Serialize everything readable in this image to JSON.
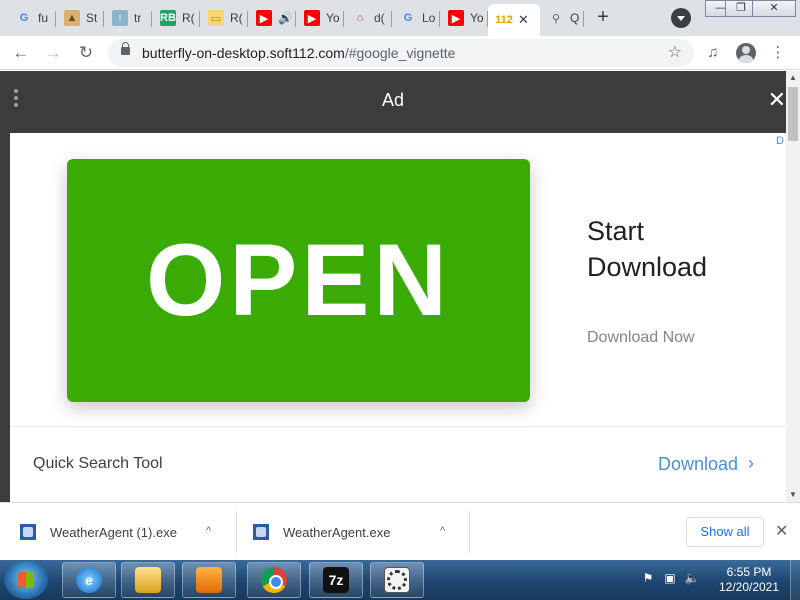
{
  "tabs": [
    {
      "icon": "google-icon",
      "glyph": "G",
      "color": "#4285f4",
      "bg": "transparent",
      "title": "fu"
    },
    {
      "icon": "animal-icon",
      "glyph": "▲",
      "color": "#6b4a1e",
      "bg": "#d9b16a",
      "title": "St"
    },
    {
      "icon": "upload-icon",
      "glyph": "↑",
      "color": "#ffffff",
      "bg": "#8ab4c8",
      "title": "tr"
    },
    {
      "icon": "rb-icon",
      "glyph": "RB",
      "color": "#ffffff",
      "bg": "#1fa463",
      "title": "R("
    },
    {
      "icon": "bookmark-folder-icon",
      "glyph": "▭",
      "color": "#b88a1a",
      "bg": "#f7d774",
      "title": "R("
    },
    {
      "icon": "youtube-icon",
      "glyph": "▶",
      "color": "#ffffff",
      "bg": "#ff0000",
      "title": "🔊"
    },
    {
      "icon": "youtube-icon",
      "glyph": "▶",
      "color": "#ffffff",
      "bg": "#ff0000",
      "title": "Yo"
    },
    {
      "icon": "store-icon",
      "glyph": "⌂",
      "color": "#e8413c",
      "bg": "transparent",
      "title": "d("
    },
    {
      "icon": "google-icon",
      "glyph": "G",
      "color": "#4285f4",
      "bg": "transparent",
      "title": "Lo"
    },
    {
      "icon": "youtube-icon",
      "glyph": "▶",
      "color": "#ffffff",
      "bg": "#ff0000",
      "title": "Yo"
    },
    {
      "icon": "soft112-icon",
      "glyph": "112",
      "color": "#e8a000",
      "bg": "transparent",
      "title": "",
      "active": true,
      "close": "✕"
    },
    {
      "icon": "search-icon",
      "glyph": "⚲",
      "color": "#5f6368",
      "bg": "transparent",
      "title": "Q"
    }
  ],
  "newtab_label": "+",
  "window": {
    "minimize": "—",
    "maximize": "❐",
    "close": "✕"
  },
  "toolbar": {
    "back": "←",
    "forward": "→",
    "reload": "↻",
    "url_host": "butterfly-on-desktop.soft112.com",
    "url_path": "/#google_vignette",
    "star": "☆",
    "media": "♫",
    "menu": "⋮"
  },
  "ad": {
    "label": "Ad",
    "close": "✕",
    "open_text": "OPEN",
    "headline": "Start Download",
    "download_now": "Download Now",
    "adchoices": "D",
    "quick_search": "Quick Search Tool",
    "download_link": "Download",
    "chevron": "›",
    "accent": "#3aaa05",
    "link_color": "#4a90d9"
  },
  "scroll": {
    "up": "▲",
    "down": "▼"
  },
  "shelf": {
    "items": [
      {
        "filename": "WeatherAgent (1).exe",
        "chevron": "^"
      },
      {
        "filename": "WeatherAgent.exe",
        "chevron": "^"
      }
    ],
    "show_all": "Show all",
    "close": "✕"
  },
  "taskbar": {
    "apps": [
      "internet-explorer",
      "file-explorer",
      "media-center",
      "chrome",
      "7-zip",
      "weather-agent"
    ],
    "sevenz_label": "7z",
    "ie_label": "e",
    "tray": [
      "⚑",
      "▣",
      "🔈"
    ],
    "time": "6:55 PM",
    "date": "12/20/2021"
  }
}
